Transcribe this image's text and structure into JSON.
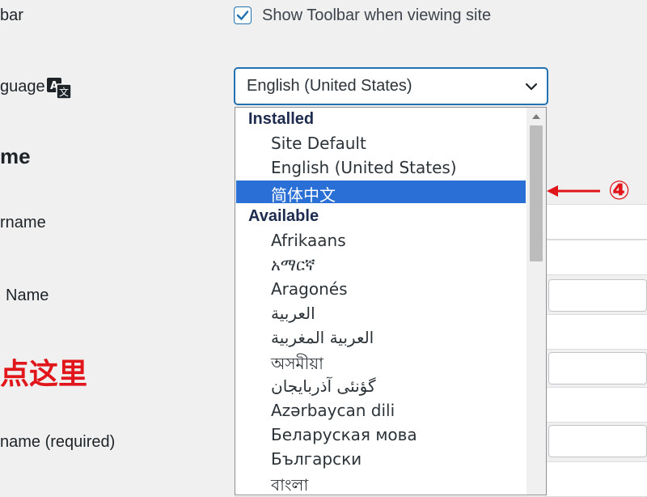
{
  "form": {
    "toolbar_label": "bar",
    "toolbar_checkbox_label": "Show Toolbar when viewing site",
    "language_label": "guage",
    "name_heading": "me",
    "username_label": "rname",
    "first_name_label": "Name",
    "red_note": "点这里",
    "nickname_label": "name (required)"
  },
  "language_select": {
    "current_value": "English (United States)",
    "groups": [
      {
        "label": "Installed",
        "options": [
          "Site Default",
          "English (United States)",
          "简体中文"
        ]
      },
      {
        "label": "Available",
        "options": [
          "Afrikaans",
          "አማርኛ",
          "Aragonés",
          "العربية",
          "العربية المغربية",
          "অসমীয়া",
          "گؤنئی آذربایجان",
          "Azərbaycan dili",
          "Беларуская мова",
          "Български",
          "বাংলা"
        ]
      }
    ],
    "selected_option": "简体中文"
  },
  "annotation": {
    "step_marker": "④",
    "color": "#e0161a"
  },
  "colors": {
    "accent": "#2271b1",
    "selected_bg": "#2a6fd6",
    "page_bg": "#f0f0f1"
  }
}
